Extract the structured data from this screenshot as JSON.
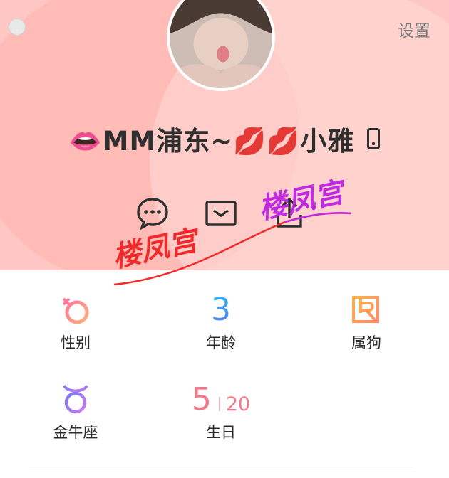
{
  "header": {
    "settings_label": "设置",
    "nickname": "👄MM浦东~💋💋小雅",
    "actions": [
      {
        "icon": "chat-icon"
      },
      {
        "icon": "mail-icon"
      },
      {
        "icon": "share-icon"
      }
    ]
  },
  "watermark": {
    "text1": "楼凤宫",
    "text2": "楼凤宫"
  },
  "profile": {
    "gender": {
      "label": "性别",
      "icon": "female-symbol-icon"
    },
    "age": {
      "label": "年龄",
      "value": "3"
    },
    "zodiac": {
      "label": "属狗",
      "icon": "zodiac-dog-icon"
    },
    "constellation": {
      "label": "金牛座",
      "icon": "taurus-icon"
    },
    "birthday": {
      "label": "生日",
      "month": "5",
      "day": "20"
    }
  },
  "colors": {
    "header_bg": "#ffc7c3",
    "accent_red": "#f02a2a",
    "accent_purple": "#c02ae0"
  }
}
